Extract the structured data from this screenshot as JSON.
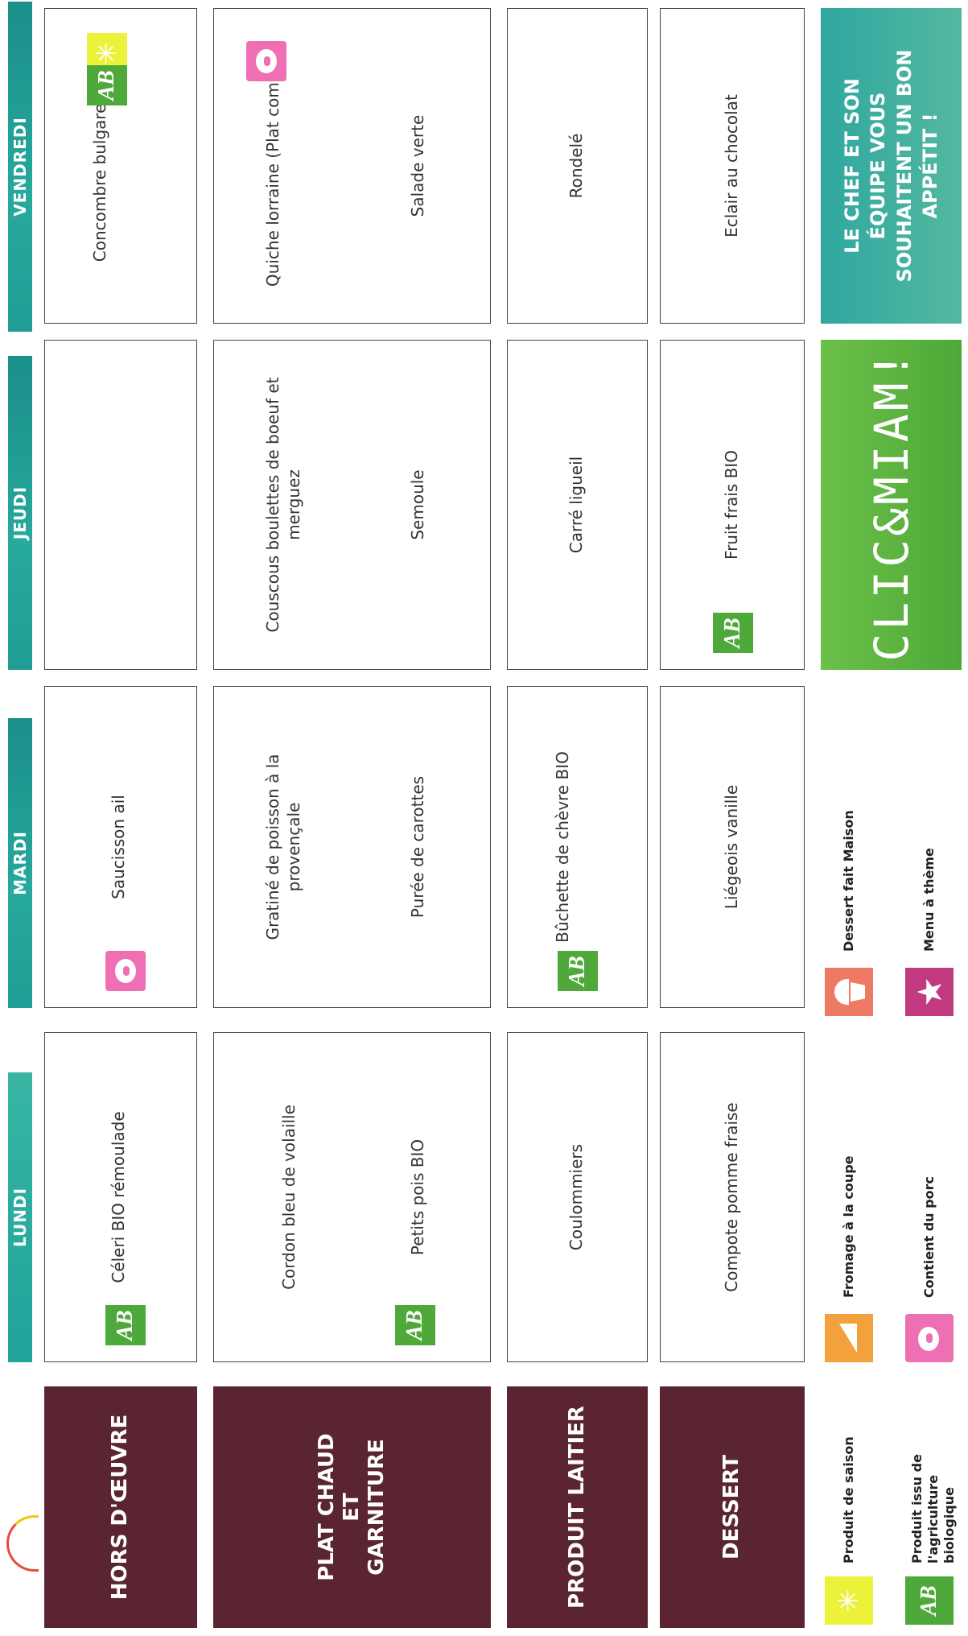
{
  "days": [
    "LUNDI",
    "MARDI",
    "JEUDI",
    "VENDREDI"
  ],
  "categories": [
    "HORS D'ŒUVRE",
    "PLAT CHAUD ET GARNITURE",
    "PRODUIT LAITIER",
    "DESSERT"
  ],
  "menu": {
    "lundi": {
      "hors_doeuvre": "Céleri BIO rémoulade",
      "plat": "Cordon bleu de volaille",
      "garniture": "Petits pois BIO",
      "laitier": "Coulommiers",
      "dessert": "Compote pomme fraise"
    },
    "mardi": {
      "hors_doeuvre": "Saucisson ail",
      "plat": "Gratiné de poisson à la provençale",
      "garniture": "Purée de carottes",
      "laitier": "Bûchette de chèvre BIO",
      "dessert": "Liégeois vanille"
    },
    "jeudi": {
      "hors_doeuvre": "",
      "plat": "Couscous boulettes de boeuf et merguez",
      "garniture": "Semoule",
      "laitier": "Carré ligueil",
      "dessert": "Fruit frais BIO"
    },
    "vendredi": {
      "hors_doeuvre": "Concombre bulgare BIO",
      "plat": "Quiche lorraine (Plat complet)",
      "garniture": "Salade verte",
      "laitier": "Rondelé",
      "dessert": "Eclair au chocolat"
    }
  },
  "legend": {
    "saison": "Produit de saison",
    "bio": "Produit issu de l'agriculture biologique",
    "fromage": "Fromage à la coupe",
    "porc": "Contient du porc",
    "dessert_maison": "Dessert fait Maison",
    "theme": "Menu à thème"
  },
  "icons": {
    "bio_label": "AB",
    "sun": "sun-icon",
    "pig": "pig-icon",
    "cheese": "cheese-icon",
    "cupcake": "cupcake-icon",
    "star": "star-icon"
  },
  "banner": "CLIC&MIAM!",
  "footer_message": "LE CHEF ET SON ÉQUIPE VOUS SOUHAITENT UN BON APPÉTIT !",
  "colors": {
    "row_label": "#5a2530",
    "day_header": "#1f9d95",
    "bio_green": "#4fa83a",
    "pork_pink": "#ee6fb3",
    "banner_green": "#5db441"
  }
}
